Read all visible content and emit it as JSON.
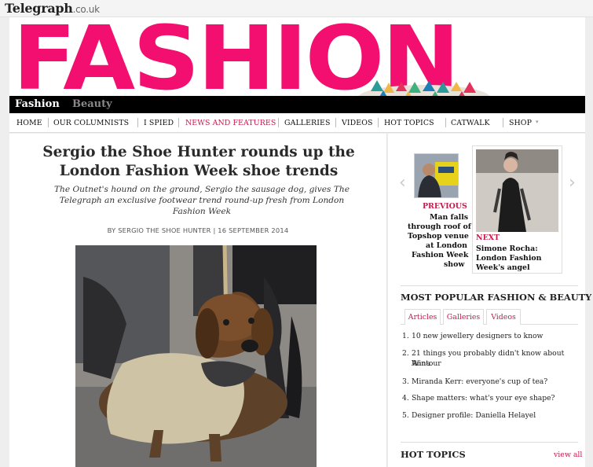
{
  "site": {
    "logo": "Telegraph",
    "domain": ".co.uk"
  },
  "banner": {
    "word": "FASHION"
  },
  "tabs": {
    "active": "Fashion",
    "inactive": "Beauty"
  },
  "nav": [
    "HOME",
    "OUR COLUMNISTS",
    "I SPIED",
    "NEWS AND FEATURES",
    "GALLERIES",
    "VIDEOS",
    "HOT TOPICS",
    "CATWALK",
    "SHOP"
  ],
  "nav_highlight": "NEWS AND FEATURES",
  "article": {
    "headline": "Sergio the Shoe Hunter rounds up the London Fashion Week shoe trends",
    "standfirst": "The Outnet's hound on the ground, Sergio the sausage dog, gives The Telegraph an exclusive footwear trend round-up fresh from London Fashion Week",
    "byline": "BY SERGIO THE SHOE HUNTER | 16 SEPTEMBER 2014"
  },
  "sidebar": {
    "previous": {
      "label": "PREVIOUS",
      "title": [
        "Man falls",
        "through roof of",
        "Topshop venue",
        "at London",
        "Fashion Week",
        "show"
      ]
    },
    "next": {
      "label": "NEXT",
      "title": [
        "Simone Rocha:",
        "London Fashion",
        "Week's angel"
      ]
    },
    "most_popular": {
      "heading": "MOST POPULAR FASHION & BEAUTY",
      "tabs": [
        "Articles",
        "Galleries",
        "Videos"
      ],
      "items": [
        {
          "num": "1.",
          "lines": [
            "10 new jewellery designers to know"
          ]
        },
        {
          "num": "2.",
          "lines": [
            "21 things you probably didn't know about Anna",
            "Wintour"
          ]
        },
        {
          "num": "3.",
          "lines": [
            "Miranda Kerr: everyone's cup of tea?"
          ]
        },
        {
          "num": "4.",
          "lines": [
            "Shape matters: what's your eye shape?"
          ]
        },
        {
          "num": "5.",
          "lines": [
            "Designer profile: Daniella Helayel"
          ]
        }
      ]
    },
    "hot_topics": {
      "heading": "HOT TOPICS",
      "link": "view all"
    }
  },
  "colors": {
    "accent": "#c8194b",
    "banner": "#f20f6f",
    "tabbar": "#000000"
  },
  "icons": {
    "prev_arrow": "chevron-left-icon",
    "next_arrow": "chevron-right-icon"
  }
}
